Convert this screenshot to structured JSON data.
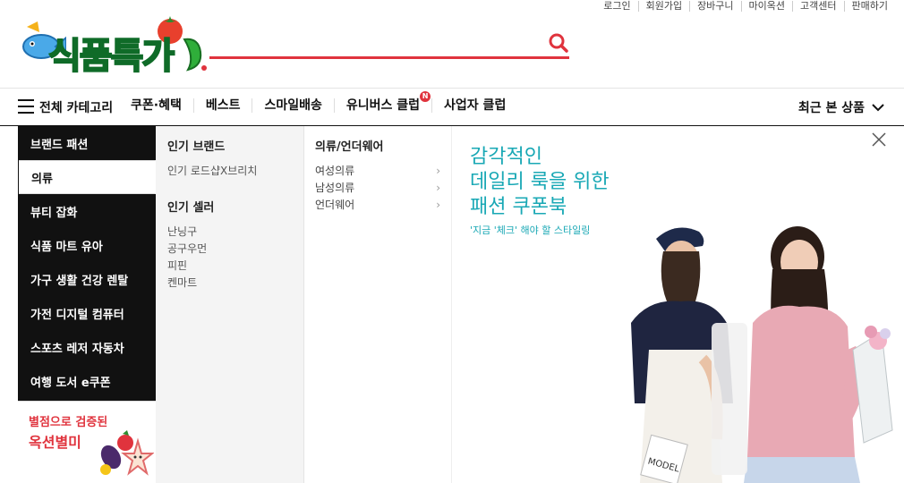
{
  "util_links": [
    "로그인",
    "회원가입",
    "장바구니",
    "마이옥션",
    "고객센터",
    "판매하기"
  ],
  "logo": {
    "text": "식품특가"
  },
  "search": {
    "value": "",
    "placeholder": ""
  },
  "nav": {
    "all_category": "전체 카테고리",
    "links": [
      "쿠폰·혜택",
      "베스트",
      "스마일배송",
      "유니버스 클럽",
      "사업자 클럽"
    ],
    "new_badge": "N",
    "recent": "최근 본 상품"
  },
  "categories": [
    "브랜드 패션",
    "의류",
    "뷰티 잡화",
    "식품 마트 유아",
    "가구 생활 건강 렌탈",
    "가전 디지털 컴퓨터",
    "스포츠 레저 자동차",
    "여행 도서 e쿠폰"
  ],
  "promo": {
    "sub": "별점으로 검증된",
    "title": "옥션별미"
  },
  "popular_brand": {
    "heading": "인기 브랜드",
    "links": [
      "인기 로드샵X브리치"
    ]
  },
  "popular_seller": {
    "heading": "인기 셀러",
    "links": [
      "난닝구",
      "공구우먼",
      "피핀",
      "켄마트"
    ]
  },
  "clothing": {
    "heading": "의류/언더웨어",
    "links": [
      "여성의류",
      "남성의류",
      "언더웨어"
    ]
  },
  "banner": {
    "lines": [
      "감각적인",
      "데일리 룩을 위한",
      "패션 쿠폰북"
    ],
    "sub": "'지금 '체크' 해야 할 스타일링",
    "book_text": "MODEL"
  },
  "colors": {
    "accent_red": "#e0333d",
    "banner_teal": "#19a8b5",
    "logo_green": "#1a9e3a"
  }
}
